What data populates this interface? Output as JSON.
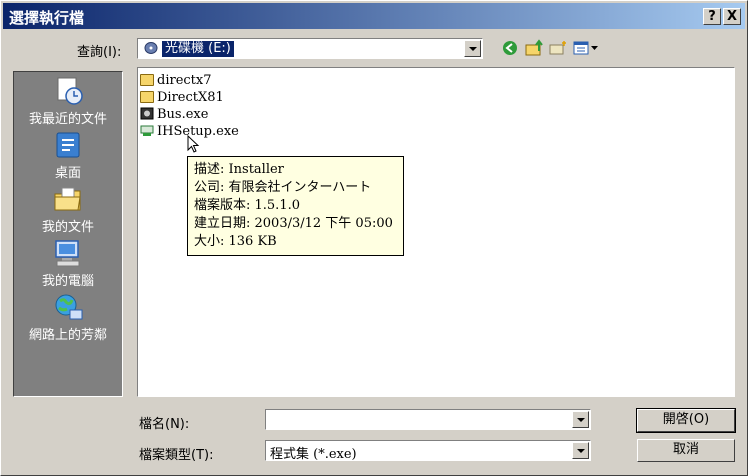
{
  "window": {
    "title": "選擇執行檔",
    "help_label": "?",
    "close_label": "X"
  },
  "lookin": {
    "label": "查詢(I):",
    "value": "光碟機 (E:)"
  },
  "places": [
    {
      "label": "我最近的文件",
      "icon": "recent-documents-icon"
    },
    {
      "label": "桌面",
      "icon": "desktop-icon"
    },
    {
      "label": "我的文件",
      "icon": "my-documents-icon"
    },
    {
      "label": "我的電腦",
      "icon": "my-computer-icon"
    },
    {
      "label": "網路上的芳鄰",
      "icon": "network-places-icon"
    }
  ],
  "files": [
    {
      "name": "directx7",
      "icon": "folder-icon"
    },
    {
      "name": "DirectX81",
      "icon": "folder-icon"
    },
    {
      "name": "Bus.exe",
      "icon": "exe-icon"
    },
    {
      "name": "IHSetup.exe",
      "icon": "setup-icon"
    }
  ],
  "tooltip": {
    "lines": [
      "描述: Installer",
      "公司: 有限会社インターハート",
      "檔案版本: 1.5.1.0",
      "建立日期: 2003/3/12 下午 05:00",
      "大小: 136 KB"
    ]
  },
  "filename": {
    "label": "檔名(N):",
    "value": ""
  },
  "filetype": {
    "label": "檔案類型(T):",
    "value": "程式集 (*.exe)"
  },
  "buttons": {
    "open": "開啓(O)",
    "cancel": "取消"
  },
  "colors": {
    "titlebar_start": "#0a246a",
    "titlebar_end": "#a6caf0",
    "tooltip_bg": "#ffffe1",
    "places_bg": "#808080"
  }
}
